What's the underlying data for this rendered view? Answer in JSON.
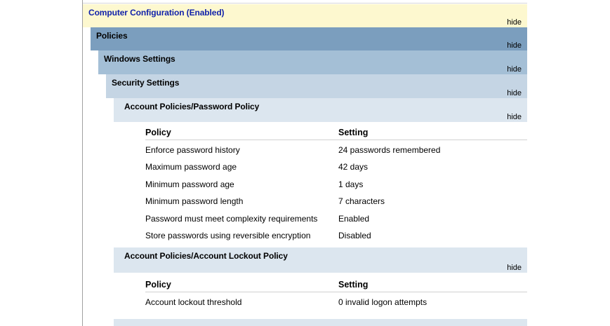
{
  "sections": {
    "computer_config": {
      "title": "Computer Configuration (Enabled)",
      "hide": "hide"
    },
    "policies": {
      "title": "Policies",
      "hide": "hide"
    },
    "windows_settings": {
      "title": "Windows Settings",
      "hide": "hide"
    },
    "security_settings": {
      "title": "Security Settings",
      "hide": "hide"
    },
    "password_policy": {
      "title": "Account Policies/Password Policy",
      "hide": "hide",
      "columns": [
        "Policy",
        "Setting"
      ],
      "rows": [
        [
          "Enforce password history",
          "24 passwords remembered"
        ],
        [
          "Maximum password age",
          "42 days"
        ],
        [
          "Minimum password age",
          "1 days"
        ],
        [
          "Minimum password length",
          "7 characters"
        ],
        [
          "Password must meet complexity requirements",
          "Enabled"
        ],
        [
          "Store passwords using reversible encryption",
          "Disabled"
        ]
      ]
    },
    "lockout_policy": {
      "title": "Account Policies/Account Lockout Policy",
      "hide": "hide",
      "columns": [
        "Policy",
        "Setting"
      ],
      "rows": [
        [
          "Account lockout threshold",
          "0 invalid logon attempts"
        ]
      ]
    }
  },
  "colors": {
    "computer_config_bg": "#fdf8cf",
    "policies_bg": "#7b9ebe",
    "windows_settings_bg": "#a4bfd6",
    "security_settings_bg": "#c5d5e4",
    "subsection_bg": "#dce6ef",
    "title_link": "#1122aa"
  }
}
